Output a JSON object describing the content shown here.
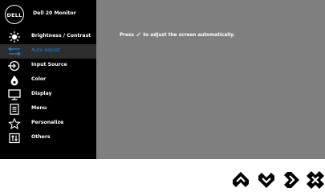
{
  "header": {
    "logo_text": "DELL",
    "title": "Dell 20 Monitor"
  },
  "menu": {
    "items": [
      {
        "label": "Brightness / Contrast",
        "icon": "brightness-icon"
      },
      {
        "label": "Auto Adjust",
        "icon": "auto-adjust-icon",
        "selected": true
      },
      {
        "label": "Input Source",
        "icon": "input-source-icon"
      },
      {
        "label": "Color",
        "icon": "color-icon"
      },
      {
        "label": "Display",
        "icon": "display-icon"
      },
      {
        "label": "Menu",
        "icon": "menu-icon"
      },
      {
        "label": "Personalize",
        "icon": "personalize-icon"
      },
      {
        "label": "Others",
        "icon": "others-icon"
      }
    ]
  },
  "content": {
    "pre": "Press ",
    "post": " to adjust the screen automatically."
  },
  "buttons": [
    {
      "icon": "up-icon"
    },
    {
      "icon": "down-icon"
    },
    {
      "icon": "right-icon"
    },
    {
      "icon": "close-icon"
    }
  ],
  "colors": {
    "sidebar": "#000000",
    "panel": "#7f7f7f",
    "selected_text": "#1f7fd6",
    "text": "#ffffff"
  }
}
